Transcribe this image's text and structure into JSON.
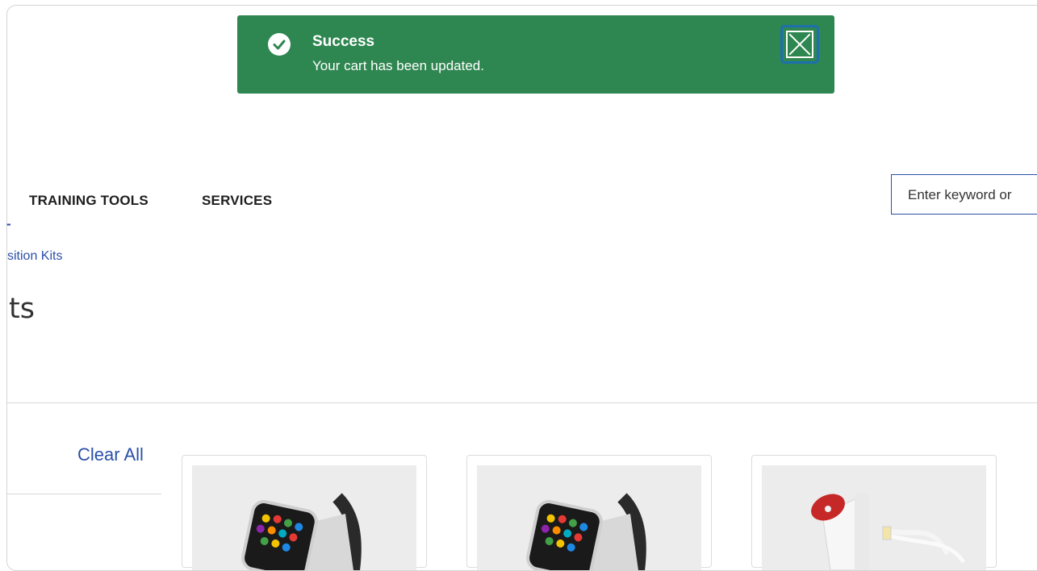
{
  "toast": {
    "title": "Success",
    "message": "Your cart has been updated."
  },
  "nav": {
    "items": [
      "TRAINING TOOLS",
      "SERVICES"
    ]
  },
  "search": {
    "placeholder": "Enter keyword or"
  },
  "breadcrumb": {
    "separator": "-",
    "current": "sition Kits"
  },
  "page": {
    "title": "ts"
  },
  "filters": {
    "clear_all": "Clear All"
  },
  "colors": {
    "toast_bg": "#2e8650",
    "link": "#2b4fa8",
    "focus_ring": "#1e6fae"
  },
  "products": [
    {
      "image_icon": "apple-watch-display-icon"
    },
    {
      "image_icon": "apple-watch-display-icon"
    },
    {
      "image_icon": "security-stand-icon"
    }
  ]
}
